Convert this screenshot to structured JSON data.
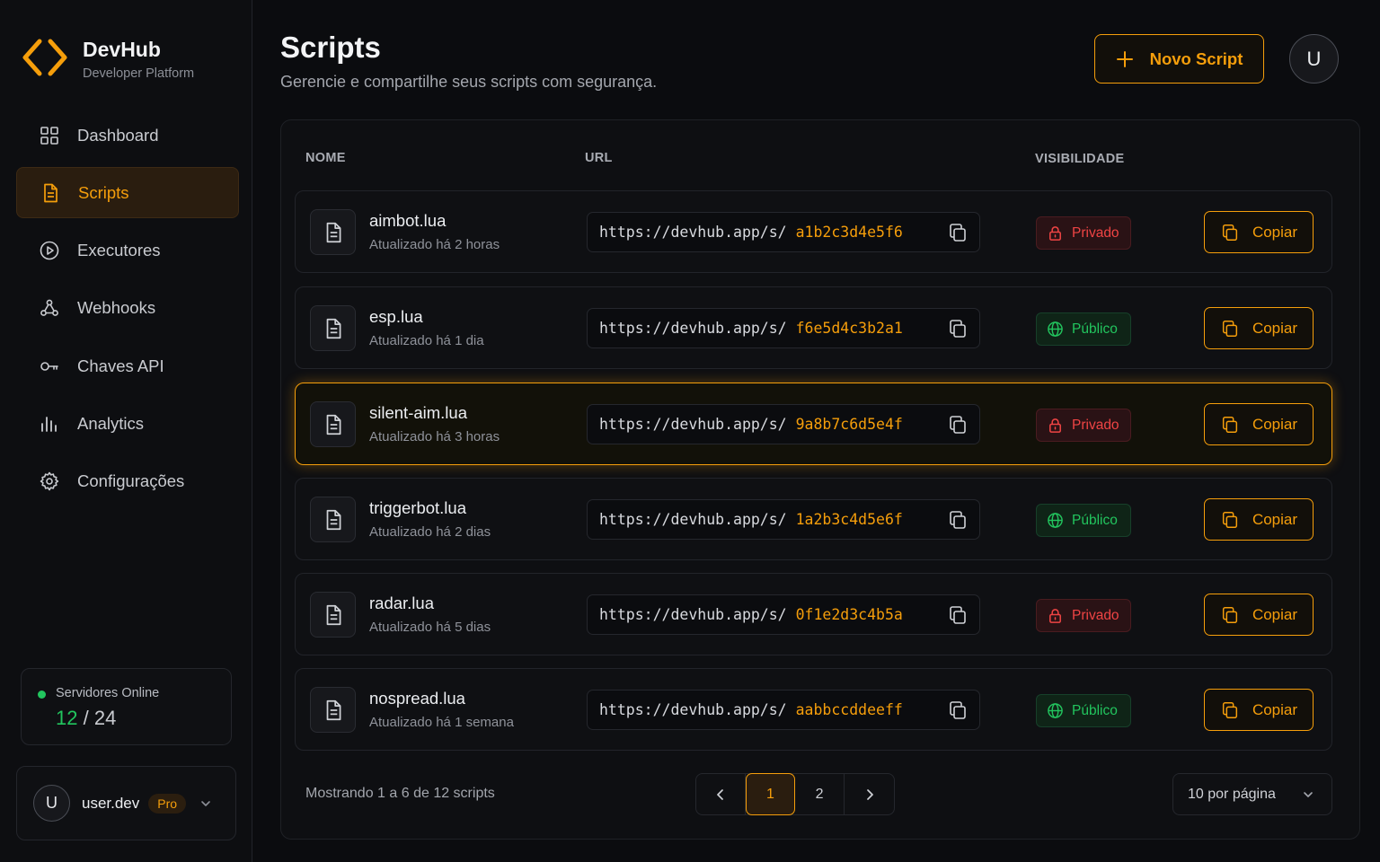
{
  "brand": {
    "name": "DevHub",
    "subtitle": "Developer Platform",
    "accent": "#f59e0b"
  },
  "sidebar": {
    "items": [
      {
        "label": "Dashboard",
        "icon": "grid-icon",
        "active": false
      },
      {
        "label": "Scripts",
        "icon": "file-icon",
        "active": true
      },
      {
        "label": "Executores",
        "icon": "play-circle-icon",
        "active": false
      },
      {
        "label": "Webhooks",
        "icon": "webhook-icon",
        "active": false
      },
      {
        "label": "Chaves API",
        "icon": "key-icon",
        "active": false
      },
      {
        "label": "Analytics",
        "icon": "bar-chart-icon",
        "active": false
      },
      {
        "label": "Configurações",
        "icon": "gear-icon",
        "active": false
      }
    ],
    "servers": {
      "label": "Servidores Online",
      "online": "12",
      "separator": "/",
      "total": "24"
    },
    "user": {
      "initial": "U",
      "name": "user.dev",
      "plan": "Pro"
    }
  },
  "header": {
    "title": "Scripts",
    "subtitle": "Gerencie e compartilhe seus scripts com segurança.",
    "new_button": "Novo Script",
    "avatar_initial": "U"
  },
  "table": {
    "columns": {
      "name": "NOME",
      "url": "URL",
      "visibility": "VISIBILIDADE"
    },
    "url_base": "https://devhub.app/s/",
    "copy_label": "Copiar",
    "rows": [
      {
        "name": "aimbot.lua",
        "updated": "Atualizado há 2 horas",
        "id": "a1b2c3d4e5f6",
        "visibility": "Privado",
        "public": false,
        "selected": false
      },
      {
        "name": "esp.lua",
        "updated": "Atualizado há 1 dia",
        "id": "f6e5d4c3b2a1",
        "visibility": "Público",
        "public": true,
        "selected": false
      },
      {
        "name": "silent-aim.lua",
        "updated": "Atualizado há 3 horas",
        "id": "9a8b7c6d5e4f",
        "visibility": "Privado",
        "public": false,
        "selected": true
      },
      {
        "name": "triggerbot.lua",
        "updated": "Atualizado há 2 dias",
        "id": "1a2b3c4d5e6f",
        "visibility": "Público",
        "public": true,
        "selected": false
      },
      {
        "name": "radar.lua",
        "updated": "Atualizado há 5 dias",
        "id": "0f1e2d3c4b5a",
        "visibility": "Privado",
        "public": false,
        "selected": false
      },
      {
        "name": "nospread.lua",
        "updated": "Atualizado há 1 semana",
        "id": "aabbccddeeff",
        "visibility": "Público",
        "public": true,
        "selected": false
      }
    ]
  },
  "footer": {
    "showing": "Mostrando 1 a 6 de 12 scripts",
    "pages": [
      "1",
      "2"
    ],
    "current_page": "1",
    "per_page": "10 por página"
  },
  "colors": {
    "accent": "#f59e0b",
    "private": "#ef4444",
    "public": "#22c55e",
    "background": "#0b0c0f"
  }
}
